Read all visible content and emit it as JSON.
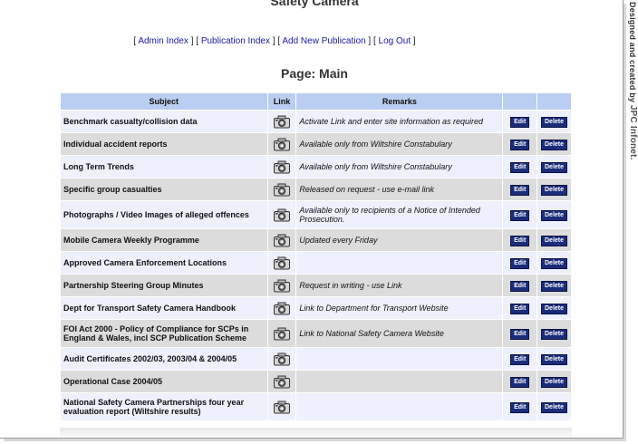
{
  "header": {
    "site_title": "Safety Camera",
    "page_title": "Page: Main"
  },
  "nav": [
    {
      "label": "Admin Index"
    },
    {
      "label": "Publication Index"
    },
    {
      "label": "Add New Publication"
    },
    {
      "label": "Log Out"
    }
  ],
  "credit": {
    "text": "Designed and created by ",
    "brand": "JPC Infonet."
  },
  "table": {
    "columns": [
      "Subject",
      "Link",
      "Remarks",
      "",
      ""
    ],
    "edit_label": "Edit",
    "delete_label": "Delete",
    "link_icon": "camera-icon",
    "rows": [
      {
        "subject": "Benchmark casualty/collision data",
        "remarks": "Activate Link and enter site information as required"
      },
      {
        "subject": "Individual accident reports",
        "remarks": "Available only from Wiltshire Constabulary"
      },
      {
        "subject": "Long Term Trends",
        "remarks": "Available only from Wiltshire Constabulary"
      },
      {
        "subject": "Specific group casualties",
        "remarks": "Released on request - use e-mail link"
      },
      {
        "subject": "Photographs / Video Images of alleged offences",
        "remarks": "Available only to recipients of a Notice of Intended Prosecution."
      },
      {
        "subject": "Mobile Camera Weekly Programme",
        "remarks": "Updated every Friday"
      },
      {
        "subject": "Approved Camera Enforcement Locations",
        "remarks": ""
      },
      {
        "subject": "Partnership Steering Group Minutes",
        "remarks": "Request in writing - use Link"
      },
      {
        "subject": "Dept for Transport Safety Camera Handbook",
        "remarks": "Link to Department for Transport Website"
      },
      {
        "subject": "FOI Act 2000 - Policy of Compliance for SCPs in England & Wales, incl SCP Publication Scheme",
        "remarks": "Link to National Safety Camera Website"
      },
      {
        "subject": "Audit Certificates 2002/03, 2003/04 & 2004/05",
        "remarks": ""
      },
      {
        "subject": "Operational Case 2004/05",
        "remarks": ""
      },
      {
        "subject": "National Safety Camera Partnerships four year evaluation report (Wiltshire results)",
        "remarks": ""
      }
    ]
  }
}
